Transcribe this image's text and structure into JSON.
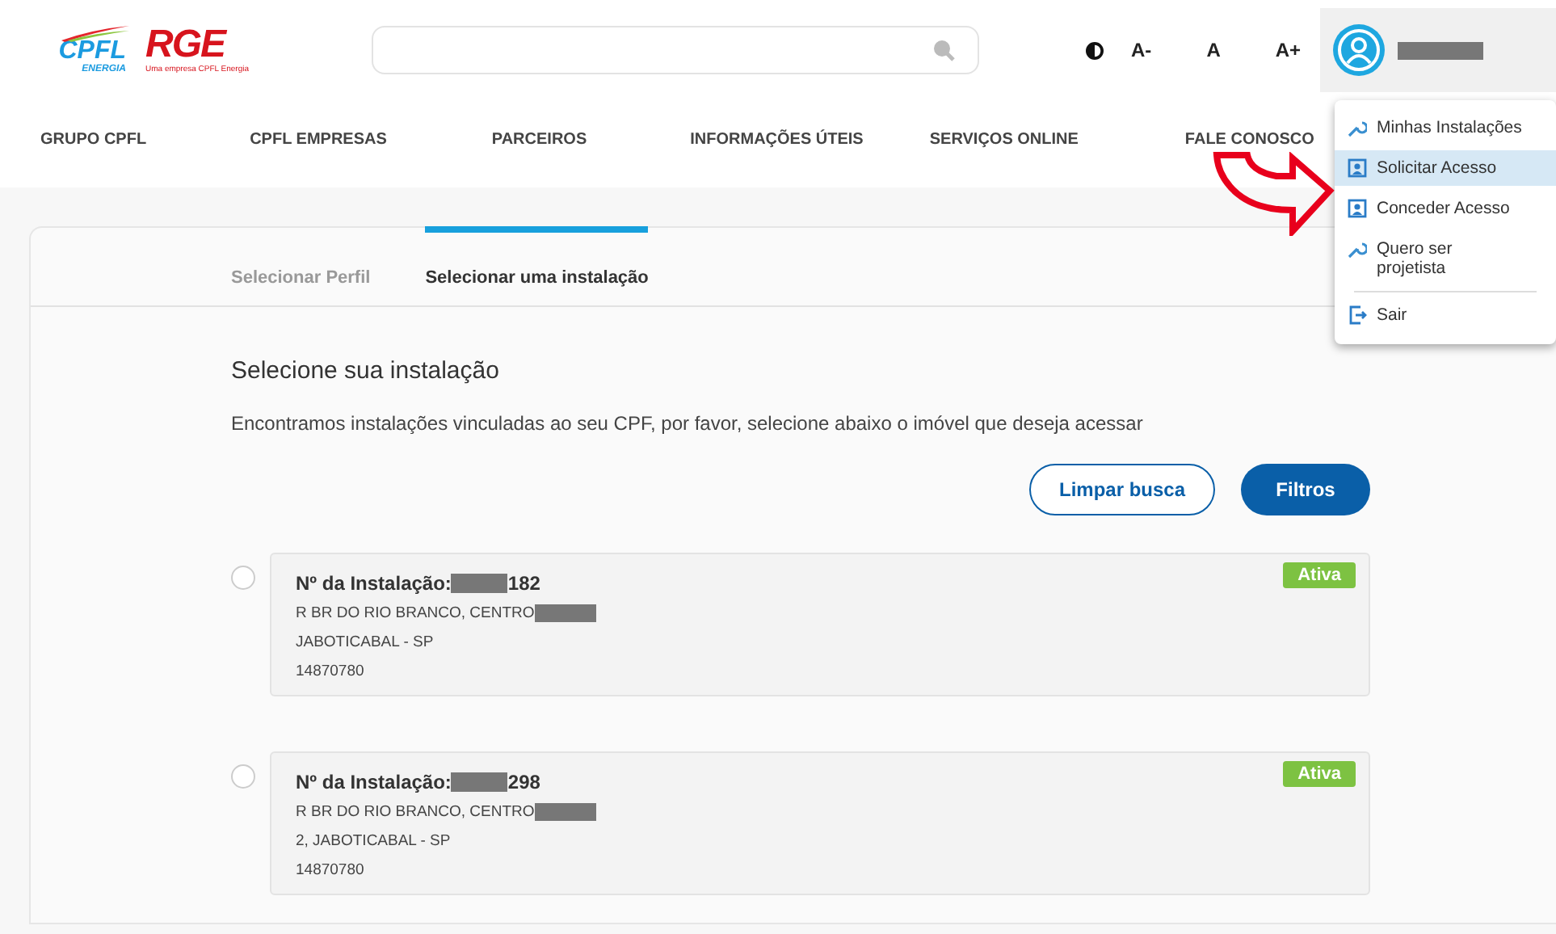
{
  "header": {
    "logos": {
      "cpfl": "CPFL",
      "cpfl_sub": "ENERGIA",
      "rge": "RGE",
      "rge_sub": "Uma empresa CPFL Energia"
    },
    "font_controls": [
      "A-",
      "A",
      "A+"
    ]
  },
  "nav": [
    "GRUPO CPFL",
    "CPFL EMPRESAS",
    "PARCEIROS",
    "INFORMAÇÕES ÚTEIS",
    "SERVIÇOS ONLINE",
    "FALE CONOSCO"
  ],
  "user_menu": {
    "items": [
      {
        "label": "Minhas Instalações",
        "kind": "wrench",
        "selected": false
      },
      {
        "label": "Solicitar Acesso",
        "kind": "card",
        "selected": true
      },
      {
        "label": "Conceder Acesso",
        "kind": "card",
        "selected": false
      },
      {
        "label": "Quero ser projetista",
        "kind": "wrench",
        "selected": false
      },
      {
        "label": "Sair",
        "kind": "exit",
        "selected": false
      }
    ]
  },
  "steps": [
    {
      "label": "Selecionar Perfil",
      "selected": false
    },
    {
      "label": "Selecionar uma instalação",
      "selected": true
    }
  ],
  "title": "Selecione sua instalação",
  "description": "Encontramos instalações vinculadas ao seu CPF, por favor, selecione abaixo o imóvel que deseja acessar",
  "buttons": [
    {
      "label": "Limpar busca",
      "kind": "outline"
    },
    {
      "label": "Filtros",
      "kind": "primary"
    }
  ],
  "installations": [
    {
      "label": "Nº da Instalação:",
      "number_suffix": "182",
      "street": "R BR DO RIO BRANCO, CENTRO",
      "city": "JABOTICABAL - SP",
      "zip": "14870780",
      "status": "Ativa",
      "selected": false
    },
    {
      "label": "Nº da Instalação:",
      "number_suffix": "298",
      "street": "R BR DO RIO BRANCO, CENTRO",
      "city": "2, JABOTICABAL - SP",
      "zip": "14870780",
      "status": "Ativa",
      "selected": false
    }
  ]
}
